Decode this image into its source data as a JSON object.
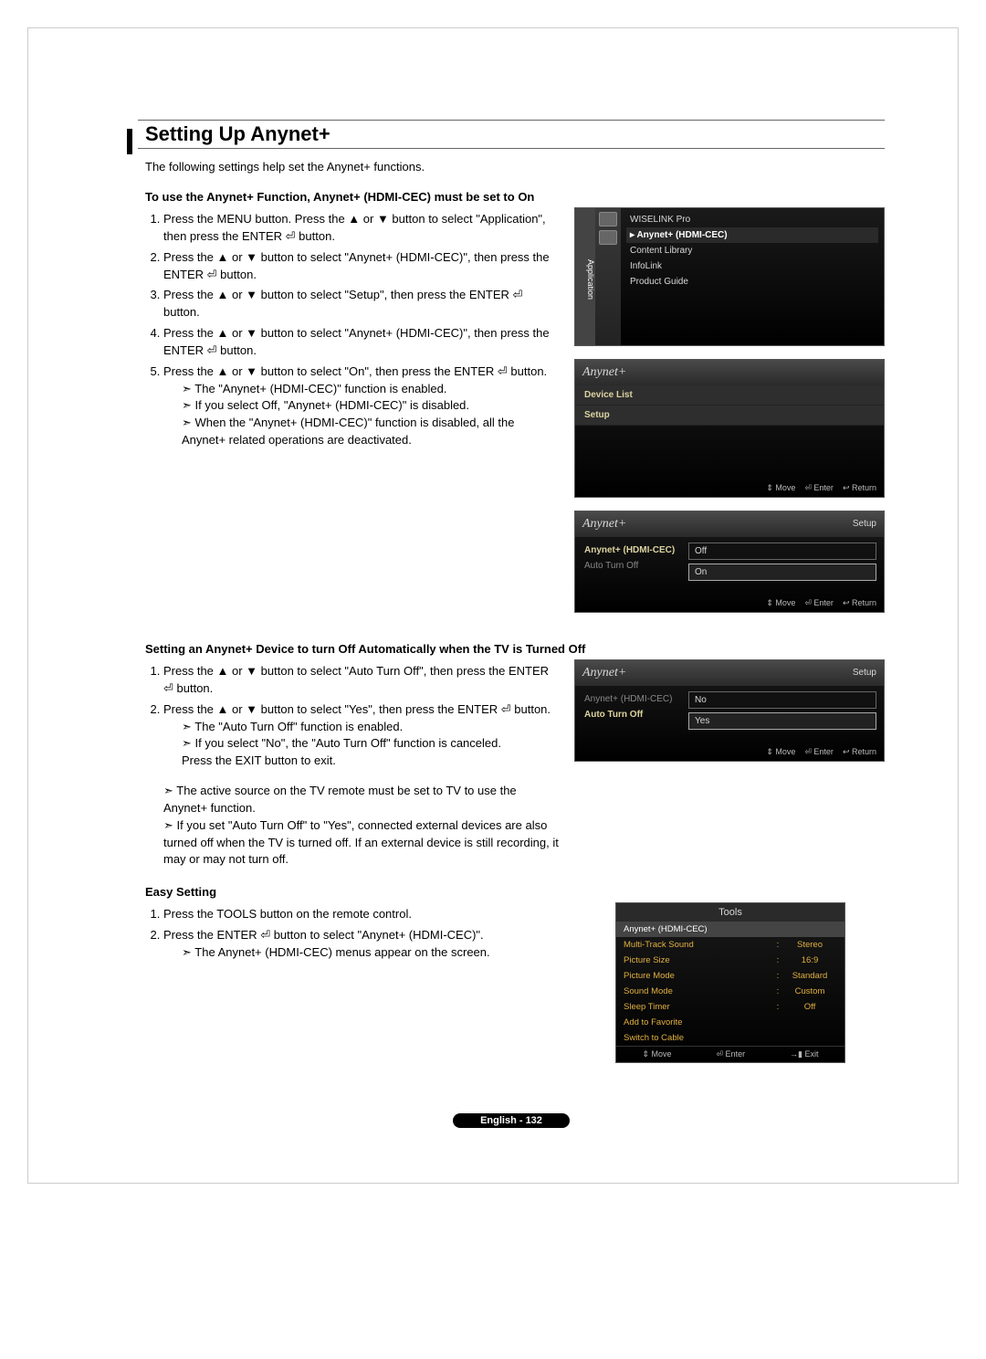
{
  "title": "Setting Up Anynet+",
  "intro": "The following settings help set the Anynet+ functions.",
  "subhead1": "To use the Anynet+ Function, Anynet+ (HDMI-CEC) must be set to On",
  "steps1": [
    "Press the MENU button. Press the ▲ or ▼ button to select \"Application\", then press the ENTER ⏎ button.",
    "Press the ▲ or ▼ button to select \"Anynet+ (HDMI-CEC)\", then press the ENTER ⏎ button.",
    "Press the ▲ or ▼ button to select \"Setup\", then press the ENTER ⏎ button.",
    "Press the ▲ or ▼ button to select \"Anynet+ (HDMI-CEC)\", then press the ENTER ⏎ button.",
    "Press the ▲ or ▼ button to select \"On\", then press the ENTER ⏎ button."
  ],
  "notes1": [
    "The \"Anynet+ (HDMI-CEC)\" function is enabled.",
    "If you select Off, \"Anynet+ (HDMI-CEC)\" is disabled.",
    "When the \"Anynet+ (HDMI-CEC)\" function is disabled, all the Anynet+ related operations are deactivated."
  ],
  "subhead2": "Setting an Anynet+ Device to turn Off Automatically when the TV is Turned Off",
  "steps2": [
    "Press the ▲ or ▼ button to select \"Auto Turn Off\", then press the ENTER ⏎ button.",
    "Press the ▲ or ▼ button to select \"Yes\", then press the ENTER ⏎ button."
  ],
  "notes2_inner": [
    "The \"Auto Turn Off\" function is enabled.",
    "If you select \"No\", the \"Auto Turn Off\" function is canceled."
  ],
  "exit_line": "Press the EXIT button to exit.",
  "notes2_outer": [
    "The active source on the TV remote must be set to TV to use the Anynet+ function.",
    "If you set \"Auto Turn Off\" to \"Yes\", connected external devices are also turned off when the TV is turned off. If an external device is still recording, it may or may not turn off."
  ],
  "subhead3": "Easy Setting",
  "steps3": [
    "Press the TOOLS button on the remote control.",
    "Press the ENTER ⏎ button to select \"Anynet+ (HDMI-CEC)\"."
  ],
  "notes3": [
    "The Anynet+ (HDMI-CEC) menus appear on the screen."
  ],
  "footer_label": "English - 132",
  "osd_app": {
    "side": "Application",
    "items": [
      "WISELINK Pro",
      "Anynet+ (HDMI-CEC)",
      "Content Library",
      "InfoLink",
      "Product Guide"
    ],
    "selected": 1
  },
  "osd_anynet": {
    "brand": "Anynet+",
    "rows": [
      "Device List",
      "Setup"
    ],
    "footer": [
      "⇕ Move",
      "⏎ Enter",
      "↩ Return"
    ]
  },
  "osd_setup1": {
    "brand": "Anynet+",
    "title": "Setup",
    "labels": [
      "Anynet+ (HDMI-CEC)",
      "Auto Turn Off"
    ],
    "options": [
      "Off",
      "On"
    ],
    "footer": [
      "⇕ Move",
      "⏎ Enter",
      "↩ Return"
    ]
  },
  "osd_setup2": {
    "brand": "Anynet+",
    "title": "Setup",
    "labels": [
      "Anynet+ (HDMI-CEC)",
      "Auto Turn Off"
    ],
    "options": [
      "No",
      "Yes"
    ],
    "footer": [
      "⇕ Move",
      "⏎ Enter",
      "↩ Return"
    ]
  },
  "osd_tools": {
    "title": "Tools",
    "rows": [
      {
        "k": "Anynet+ (HDMI-CEC)",
        "v": "",
        "sel": true
      },
      {
        "k": "Multi-Track Sound",
        "v": "Stereo"
      },
      {
        "k": "Picture Size",
        "v": "16:9"
      },
      {
        "k": "Picture Mode",
        "v": "Standard"
      },
      {
        "k": "Sound Mode",
        "v": "Custom"
      },
      {
        "k": "Sleep Timer",
        "v": "Off"
      },
      {
        "k": "Add to Favorite",
        "v": ""
      },
      {
        "k": "Switch to Cable",
        "v": ""
      }
    ],
    "footer": [
      "⇕ Move",
      "⏎ Enter",
      "→▮ Exit"
    ]
  }
}
